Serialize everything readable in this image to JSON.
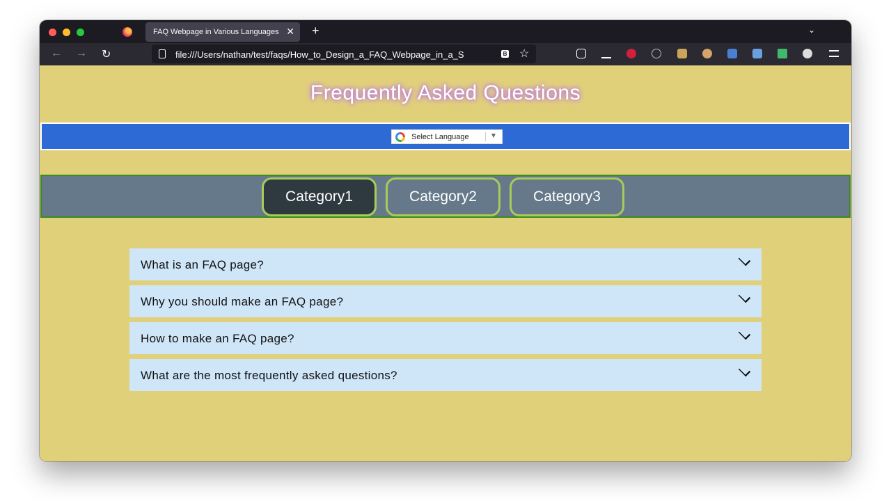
{
  "browser": {
    "tab_title": "FAQ Webpage in Various Languages",
    "tab_close": "✕",
    "new_tab": "+",
    "url": "file:///Users/nathan/test/faqs/How_to_Design_a_FAQ_Webpage_in_a_S",
    "nav_back": "←",
    "nav_forward": "→",
    "nav_reload": "↻",
    "tab_list": "⌄",
    "star": "☆"
  },
  "page": {
    "title": "Frequently Asked Questions",
    "language_select": {
      "label": "Select Language",
      "arrow": "▼"
    },
    "categories": [
      {
        "label": "Category1",
        "active": true
      },
      {
        "label": "Category2",
        "active": false
      },
      {
        "label": "Category3",
        "active": false
      }
    ],
    "faqs": [
      {
        "question": "What is an FAQ page?"
      },
      {
        "question": "Why you should make an FAQ page?"
      },
      {
        "question": "How to make an FAQ page?"
      },
      {
        "question": "What are the most frequently asked questions?"
      }
    ]
  },
  "colors": {
    "page_background": "#e1d07a",
    "language_bar": "#2e6ad6",
    "category_bar": "#65798a",
    "category_active": "#2f3a40",
    "category_border": "#a7cc5a",
    "faq_background": "#cfe6f8"
  }
}
